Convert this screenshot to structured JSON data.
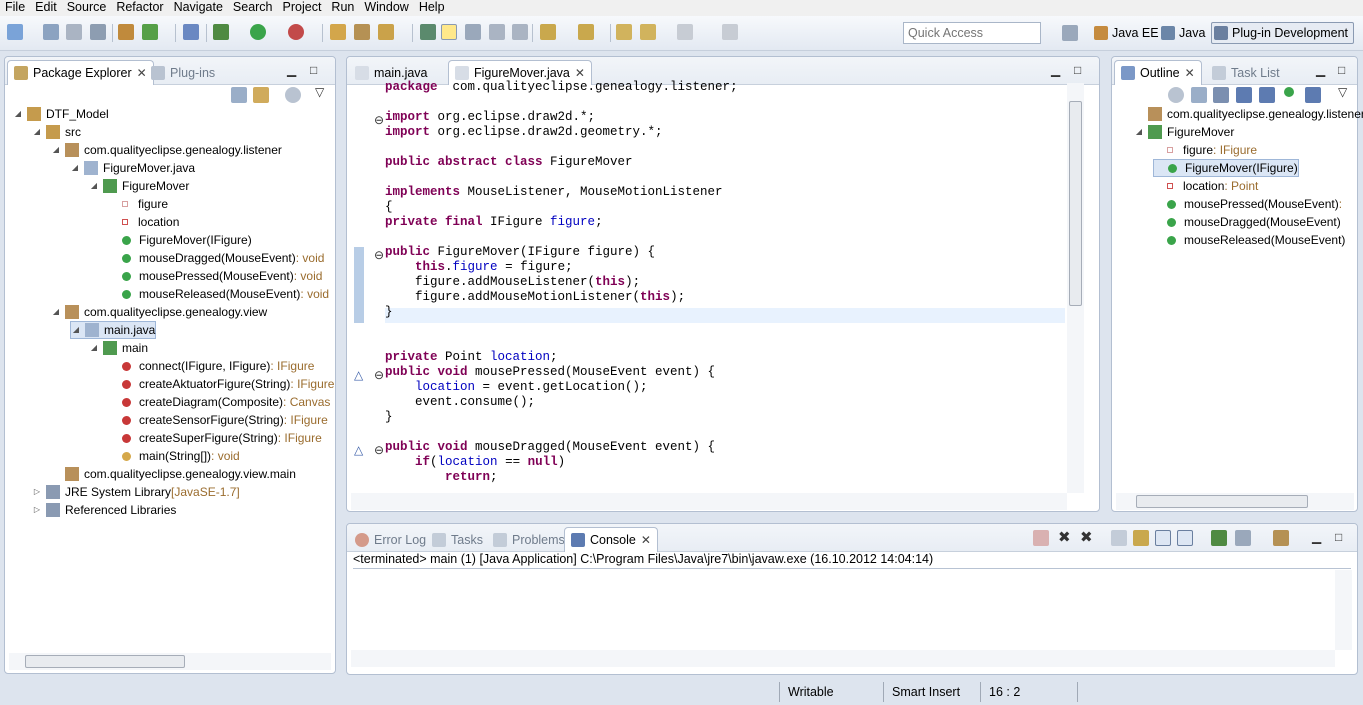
{
  "menu": [
    "File",
    "Edit",
    "Source",
    "Refactor",
    "Navigate",
    "Search",
    "Project",
    "Run",
    "Window",
    "Help"
  ],
  "quick_access": {
    "placeholder": "Quick Access"
  },
  "perspectives": [
    {
      "label": "Java EE",
      "icon": "java-ee-perspective-icon"
    },
    {
      "label": "Java",
      "icon": "java-perspective-icon"
    },
    {
      "label": "Plug-in Development",
      "icon": "plugin-perspective-icon",
      "active": true
    }
  ],
  "left_panel": {
    "tabs": [
      {
        "label": "Package Explorer",
        "active": true
      },
      {
        "label": "Plug-ins",
        "active": false
      }
    ],
    "tree": [
      {
        "label": "DTF_Model",
        "decor": "",
        "level": 0,
        "twisty": "open",
        "icon": "project-icon"
      },
      {
        "label": "src",
        "decor": "",
        "level": 1,
        "twisty": "open",
        "icon": "source-folder-icon"
      },
      {
        "label": "com.qualityeclipse.genealogy.listener",
        "decor": "",
        "level": 2,
        "twisty": "open",
        "icon": "package-icon"
      },
      {
        "label": "FigureMover.java",
        "decor": "",
        "level": 3,
        "twisty": "open",
        "icon": "java-file-icon"
      },
      {
        "label": "FigureMover",
        "decor": "",
        "level": 4,
        "twisty": "open",
        "icon": "abstract-class-icon"
      },
      {
        "label": "figure",
        "decor": "",
        "level": 5,
        "twisty": "",
        "icon": "final-field-icon"
      },
      {
        "label": "location",
        "decor": "",
        "level": 5,
        "twisty": "",
        "icon": "private-field-icon"
      },
      {
        "label": "FigureMover(IFigure)",
        "decor": "",
        "level": 5,
        "twisty": "",
        "icon": "constructor-icon"
      },
      {
        "label": "mouseDragged(MouseEvent)",
        "decor": " : void",
        "level": 5,
        "twisty": "",
        "icon": "method-icon"
      },
      {
        "label": "mousePressed(MouseEvent)",
        "decor": " : void",
        "level": 5,
        "twisty": "",
        "icon": "method-icon"
      },
      {
        "label": "mouseReleased(MouseEvent)",
        "decor": " : void",
        "level": 5,
        "twisty": "",
        "icon": "method-icon"
      },
      {
        "label": "com.qualityeclipse.genealogy.view",
        "decor": "",
        "level": 2,
        "twisty": "open",
        "icon": "package-icon"
      },
      {
        "label": "main.java",
        "decor": "",
        "level": 3,
        "twisty": "open",
        "icon": "java-file-icon",
        "selected": true
      },
      {
        "label": "main",
        "decor": "",
        "level": 4,
        "twisty": "open",
        "icon": "class-icon"
      },
      {
        "label": "connect(IFigure, IFigure)",
        "decor": " : IFigure",
        "level": 5,
        "twisty": "",
        "icon": "private-static-method-icon"
      },
      {
        "label": "createAktuatorFigure(String)",
        "decor": " : IFigure",
        "level": 5,
        "twisty": "",
        "icon": "private-static-method-icon"
      },
      {
        "label": "createDiagram(Composite)",
        "decor": " : Canvas",
        "level": 5,
        "twisty": "",
        "icon": "private-static-method-icon"
      },
      {
        "label": "createSensorFigure(String)",
        "decor": " : IFigure",
        "level": 5,
        "twisty": "",
        "icon": "private-static-method-icon"
      },
      {
        "label": "createSuperFigure(String)",
        "decor": " : IFigure",
        "level": 5,
        "twisty": "",
        "icon": "private-static-method-icon"
      },
      {
        "label": "main(String[])",
        "decor": " : void",
        "level": 5,
        "twisty": "",
        "icon": "main-method-icon"
      },
      {
        "label": "com.qualityeclipse.genealogy.view.main",
        "decor": "",
        "level": 2,
        "twisty": "",
        "icon": "package-icon"
      },
      {
        "label": "JRE System Library",
        "decor": " [JavaSE-1.7]",
        "level": 1,
        "twisty": "closed",
        "icon": "library-icon"
      },
      {
        "label": "Referenced Libraries",
        "decor": "",
        "level": 1,
        "twisty": "closed",
        "icon": "library-icon"
      }
    ]
  },
  "editor": {
    "tabs": [
      {
        "label": "main.java",
        "active": false
      },
      {
        "label": "FigureMover.java",
        "active": true
      }
    ],
    "lines": [
      [
        [
          "kw",
          "package"
        ],
        [
          "",
          "  com.qualityeclipse.genealogy.listener;"
        ]
      ],
      [],
      [
        [
          "kw",
          "import"
        ],
        [
          "",
          " org.eclipse.draw2d.*;"
        ]
      ],
      [
        [
          "kw",
          "import"
        ],
        [
          "",
          " org.eclipse.draw2d.geometry.*;"
        ]
      ],
      [],
      [
        [
          "kw",
          "public abstract class"
        ],
        [
          "",
          " FigureMover"
        ]
      ],
      [],
      [
        [
          "kw",
          "implements"
        ],
        [
          "",
          " MouseListener, MouseMotionListener"
        ]
      ],
      [
        [
          "",
          "{"
        ]
      ],
      [
        [
          "kw",
          "private final"
        ],
        [
          "",
          " IFigure "
        ],
        [
          "fld",
          "figure"
        ],
        [
          "",
          ";"
        ]
      ],
      [],
      [
        [
          "kw",
          "public"
        ],
        [
          "",
          " FigureMover(IFigure figure) {"
        ]
      ],
      [
        [
          "",
          "    "
        ],
        [
          "kw",
          "this"
        ],
        [
          "",
          "."
        ],
        [
          "fld",
          "figure"
        ],
        [
          "",
          " = figure;"
        ]
      ],
      [
        [
          "",
          "    figure.addMouseListener("
        ],
        [
          "kw",
          "this"
        ],
        [
          "",
          ");"
        ]
      ],
      [
        [
          "",
          "    figure.addMouseMotionListener("
        ],
        [
          "kw",
          "this"
        ],
        [
          "",
          ");"
        ]
      ],
      [
        [
          "",
          "}"
        ]
      ],
      [],
      [],
      [
        [
          "kw",
          "private"
        ],
        [
          "",
          " Point "
        ],
        [
          "fld",
          "location"
        ],
        [
          "",
          ";"
        ]
      ],
      [
        [
          "kw",
          "public void"
        ],
        [
          "",
          " mousePressed(MouseEvent event) {"
        ]
      ],
      [
        [
          "",
          "    "
        ],
        [
          "fld",
          "location"
        ],
        [
          "",
          " = event.getLocation();"
        ]
      ],
      [
        [
          "",
          "    event.consume();"
        ]
      ],
      [
        [
          "",
          "}"
        ]
      ],
      [],
      [
        [
          "kw",
          "public void"
        ],
        [
          "",
          " mouseDragged(MouseEvent event) {"
        ]
      ],
      [
        [
          "",
          "    "
        ],
        [
          "kw",
          "if"
        ],
        [
          "",
          "("
        ],
        [
          "fld",
          "location"
        ],
        [
          "",
          " == "
        ],
        [
          "kw",
          "null"
        ],
        [
          "",
          ")"
        ]
      ],
      [
        [
          "",
          "        "
        ],
        [
          "kw",
          "return"
        ],
        [
          "",
          ";"
        ]
      ]
    ]
  },
  "outline": {
    "tabs": [
      {
        "label": "Outline",
        "active": true
      },
      {
        "label": "Task List",
        "active": false
      }
    ],
    "items": [
      {
        "label": "com.qualityeclipse.genealogy.listener",
        "decor": "",
        "level": 0,
        "twisty": "",
        "icon": "package-icon"
      },
      {
        "label": "FigureMover",
        "decor": "",
        "level": 0,
        "twisty": "open",
        "icon": "abstract-class-icon"
      },
      {
        "label": "figure",
        "decor": " : IFigure",
        "level": 1,
        "twisty": "",
        "icon": "final-field-icon"
      },
      {
        "label": "FigureMover(IFigure)",
        "decor": "",
        "level": 1,
        "twisty": "",
        "icon": "constructor-icon",
        "selected": true
      },
      {
        "label": "location",
        "decor": " : Point",
        "level": 1,
        "twisty": "",
        "icon": "private-field-icon"
      },
      {
        "label": "mousePressed(MouseEvent)",
        "decor": " :",
        "level": 1,
        "twisty": "",
        "icon": "method-icon"
      },
      {
        "label": "mouseDragged(MouseEvent)",
        "decor": "",
        "level": 1,
        "twisty": "",
        "icon": "method-icon"
      },
      {
        "label": "mouseReleased(MouseEvent)",
        "decor": "",
        "level": 1,
        "twisty": "",
        "icon": "method-icon"
      }
    ]
  },
  "console": {
    "tabs": [
      {
        "label": "Error Log",
        "active": false
      },
      {
        "label": "Tasks",
        "active": false
      },
      {
        "label": "Problems",
        "active": false
      },
      {
        "label": "Console",
        "active": true
      }
    ],
    "text": "<terminated> main (1) [Java Application] C:\\Program Files\\Java\\jre7\\bin\\javaw.exe (16.10.2012 14:04:14)"
  },
  "status": {
    "writable": "Writable",
    "insert_mode": "Smart Insert",
    "position": "16 : 2"
  },
  "colors": {
    "keyword": "#7f0055",
    "field": "#0000c0",
    "decoration": "#9a6c2e",
    "selection": "#dbe6f5"
  }
}
